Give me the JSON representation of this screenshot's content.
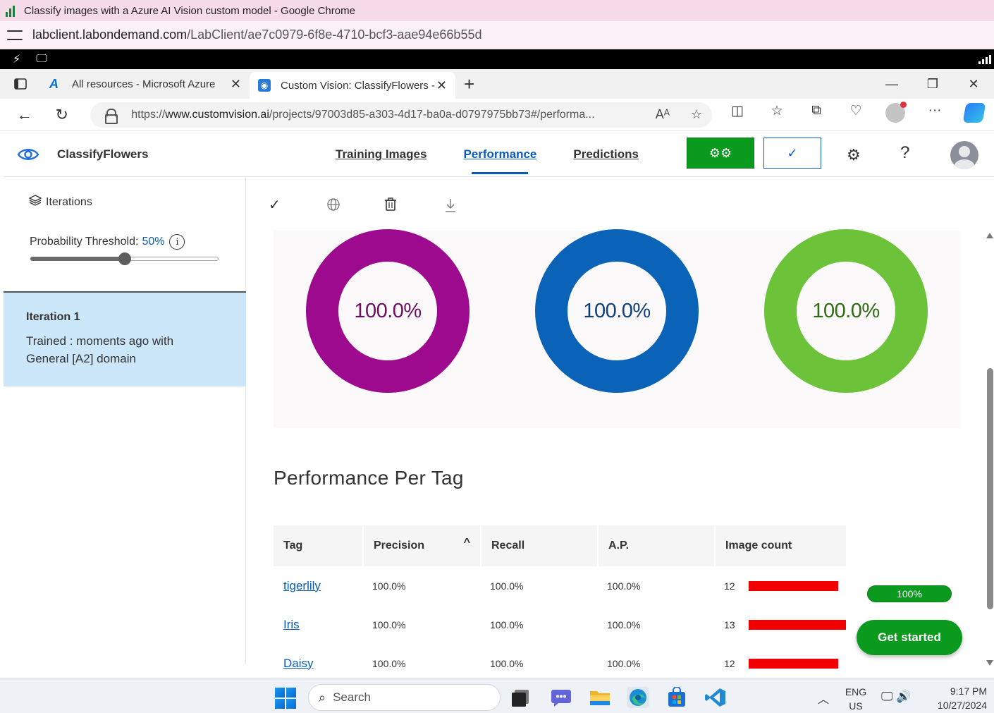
{
  "chrome": {
    "window_title": "Classify images with a Azure AI Vision custom model - Google Chrome",
    "url_host": "labclient.labondemand.com",
    "url_path": "/LabClient/ae7c0979-6f8e-4710-bcf3-aae94e66b55d"
  },
  "edge": {
    "tabs": [
      {
        "label": "All resources - Microsoft Azure",
        "icon": "azure-logo-icon",
        "active": false
      },
      {
        "label": "Custom Vision: ClassifyFlowers - ",
        "icon": "custom-vision-icon",
        "active": true
      }
    ],
    "address": {
      "prefix": "https://",
      "host": "www.customvision.ai",
      "path": "/projects/97003d85-a303-4d17-ba0a-d0797975bb73#/performa..."
    }
  },
  "app": {
    "project_name": "ClassifyFlowers",
    "nav": [
      {
        "label": "Training Images",
        "active": false
      },
      {
        "label": "Performance",
        "active": true
      },
      {
        "label": "Predictions",
        "active": false
      }
    ],
    "colors": {
      "train": "#0a9a1e",
      "accent": "#0b5cba"
    }
  },
  "sidebar": {
    "iterations_label": "Iterations",
    "probability_label": "Probability Threshold:",
    "probability_value": "50%",
    "probability_fraction": 0.5,
    "iteration": {
      "name": "Iteration 1",
      "description": "Trained : moments ago with General [A2] domain"
    }
  },
  "metrics": {
    "gauges": [
      {
        "value_text": "100.0%",
        "value": 1.0,
        "color": "#9e0a8e",
        "text_color": "#6a0f5f"
      },
      {
        "value_text": "100.0%",
        "value": 1.0,
        "color": "#0b63b8",
        "text_color": "#0f3f78"
      },
      {
        "value_text": "100.0%",
        "value": 1.0,
        "color": "#6cc33a",
        "text_color": "#2f6a14"
      }
    ]
  },
  "per_tag": {
    "title": "Performance Per Tag",
    "headers": [
      "Tag",
      "Precision",
      "Recall",
      "A.P.",
      "Image count"
    ],
    "rows": [
      {
        "tag": "tigerlily",
        "precision": "100.0%",
        "recall": "100.0%",
        "ap": "100.0%",
        "image_count": "12",
        "count": 12
      },
      {
        "tag": "Iris",
        "precision": "100.0%",
        "recall": "100.0%",
        "ap": "100.0%",
        "image_count": "13",
        "count": 13
      },
      {
        "tag": "Daisy",
        "precision": "100.0%",
        "recall": "100.0%",
        "ap": "100.0%",
        "image_count": "12",
        "count": 12
      }
    ]
  },
  "lab": {
    "progress_label": "100%",
    "progress": 1.0,
    "get_started_label": "Get started"
  },
  "taskbar": {
    "search_placeholder": "Search",
    "lang_line1": "ENG",
    "lang_line2": "US",
    "time": "9:17 PM",
    "date": "10/27/2024"
  }
}
